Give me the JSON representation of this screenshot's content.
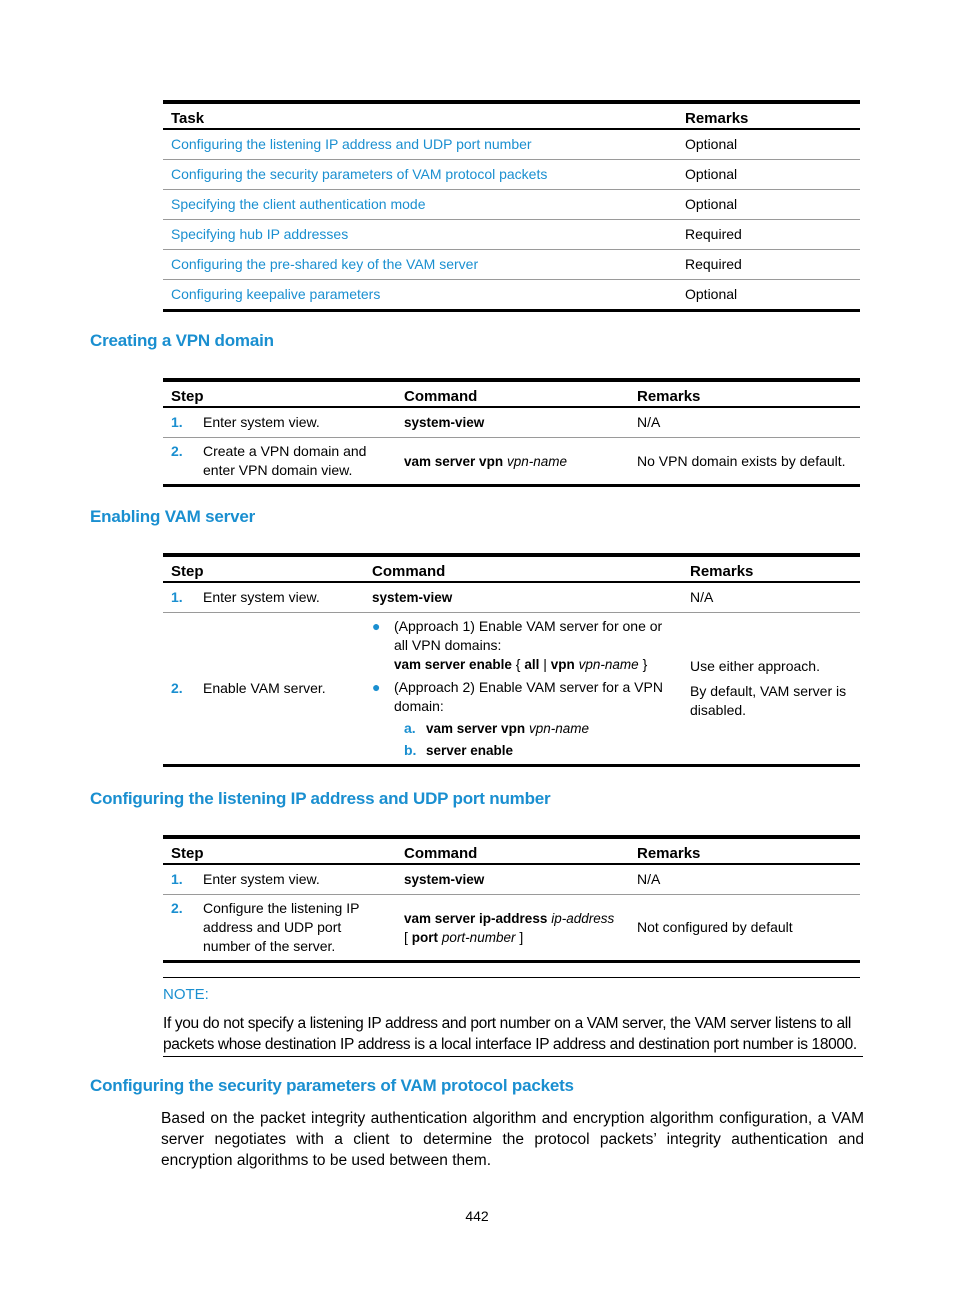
{
  "task_table": {
    "headers": [
      "Task",
      "Remarks"
    ],
    "rows": [
      {
        "task": "Configuring the listening IP address and UDP port number",
        "remarks": "Optional"
      },
      {
        "task": "Configuring the security parameters of VAM protocol packets",
        "remarks": "Optional"
      },
      {
        "task": "Specifying the client authentication mode",
        "remarks": "Optional"
      },
      {
        "task": "Specifying hub IP addresses",
        "remarks": "Required"
      },
      {
        "task": "Configuring the pre-shared key of the VAM server",
        "remarks": "Required"
      },
      {
        "task": "Configuring keepalive parameters",
        "remarks": "Optional"
      }
    ]
  },
  "section_vpn_domain": {
    "heading": "Creating a VPN domain",
    "headers": [
      "Step",
      "Command",
      "Remarks"
    ],
    "rows": [
      {
        "num": "1.",
        "step": "Enter system view.",
        "cmd": "system-view",
        "arg": "",
        "remarks": "N/A"
      },
      {
        "num": "2.",
        "step_line1": "Create a VPN domain and",
        "step_line2": "enter VPN domain view.",
        "cmd": "vam server vpn",
        "arg": "vpn-name",
        "remarks": "No VPN domain exists by default."
      }
    ]
  },
  "section_enable": {
    "heading": "Enabling VAM server",
    "headers": [
      "Step",
      "Command",
      "Remarks"
    ],
    "rows": [
      {
        "num": "1.",
        "step": "Enter system view.",
        "cmd": "system-view",
        "remarks": "N/A"
      },
      {
        "num": "2.",
        "step": "Enable VAM server.",
        "approach1": "(Approach 1) Enable VAM server for one or all VPN domains:",
        "approach1_cmd": "vam server enable",
        "approach1_brace_open": "{",
        "approach1_all": "all",
        "approach1_pipe": "|",
        "approach1_vpn": "vpn",
        "approach1_arg": "vpn-name",
        "approach1_brace_close": "}",
        "approach2": "(Approach 2) Enable VAM server for a VPN domain:",
        "sub_a_label": "a.",
        "sub_a_cmd": "vam server vpn",
        "sub_a_arg": "vpn-name",
        "sub_b_label": "b.",
        "sub_b_cmd": "server enable",
        "remarks1": "Use either approach.",
        "remarks2": "By default, VAM server is disabled."
      }
    ]
  },
  "section_listen": {
    "heading": "Configuring the listening IP address and UDP port number",
    "headers": [
      "Step",
      "Command",
      "Remarks"
    ],
    "rows": [
      {
        "num": "1.",
        "step": "Enter system view.",
        "cmd": "system-view",
        "remarks": "N/A"
      },
      {
        "num": "2.",
        "step": "Configure the listening IP address and UDP port number of the server.",
        "cmd": "vam server ip-address",
        "arg": "ip-address",
        "opt_open": "[",
        "opt_cmd": "port",
        "opt_arg": "port-number",
        "opt_close": "]",
        "remarks": "Not configured by default"
      }
    ],
    "note_label": "NOTE:",
    "note_text": "If you do not specify a listening IP address and port number on a VAM server, the VAM server listens to all packets whose destination IP address is a local interface IP address and destination port number is 18000."
  },
  "section_security": {
    "heading": "Configuring the security parameters of VAM protocol packets",
    "paragraph": "Based on the packet integrity authentication algorithm and encryption algorithm configuration, a VAM server negotiates with a client to determine the protocol packets’ integrity authentication and encryption algorithms to be used between them."
  },
  "page_number": "442",
  "colors": {
    "accent": "#1a8fd0",
    "text": "#000000"
  }
}
